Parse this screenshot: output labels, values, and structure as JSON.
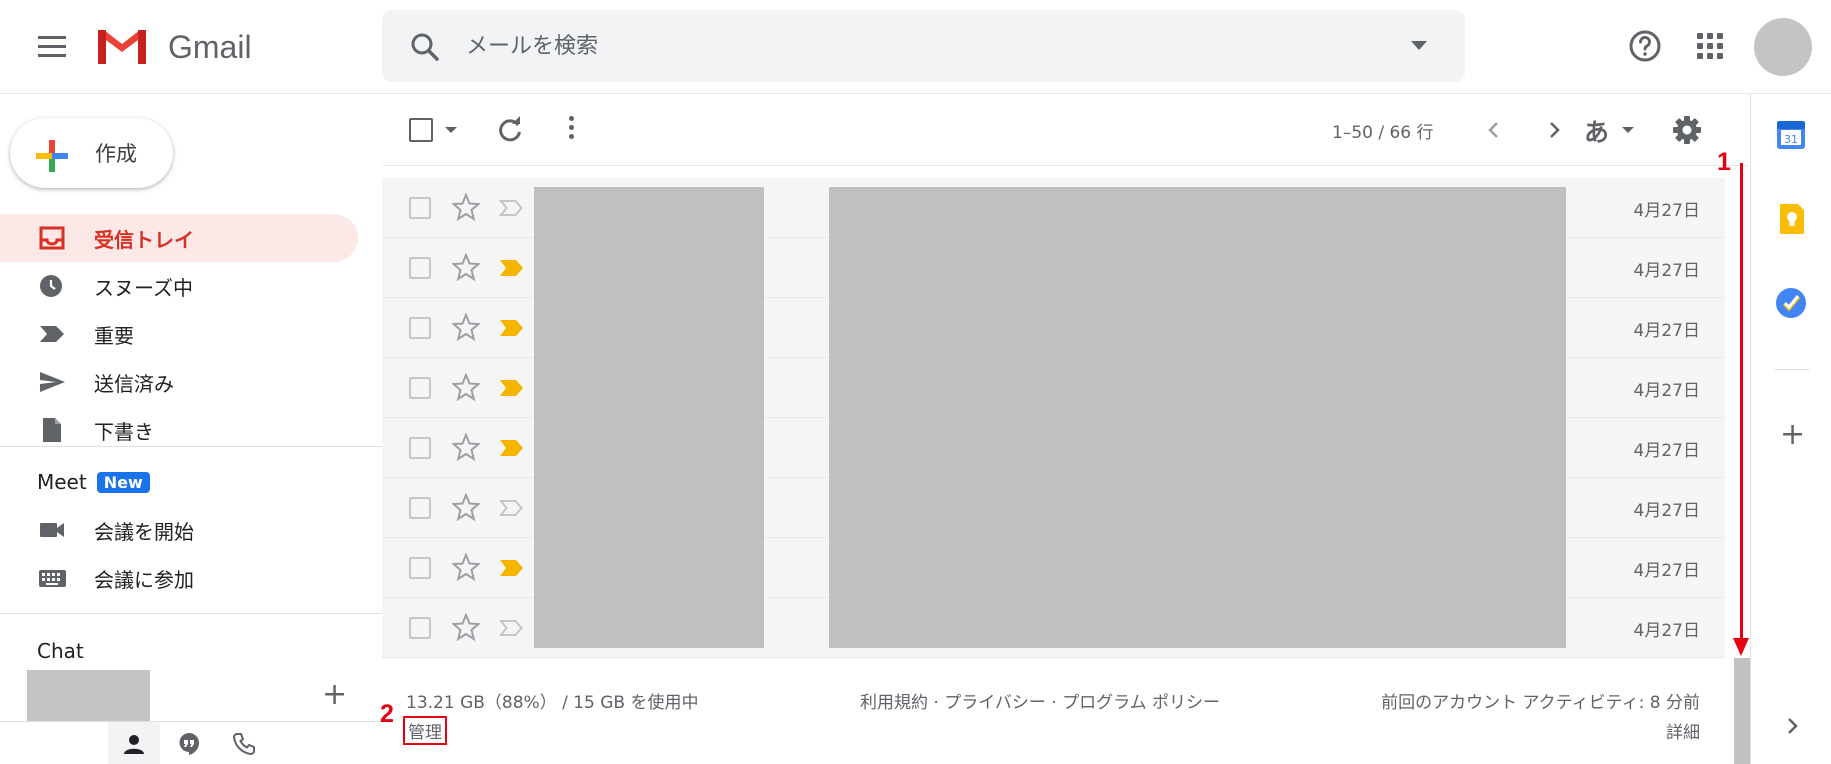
{
  "app": {
    "name": "Gmail"
  },
  "search": {
    "placeholder": "メールを検索"
  },
  "compose": {
    "label": "作成"
  },
  "nav": [
    {
      "label": "受信トレイ",
      "icon": "inbox-icon",
      "active": true
    },
    {
      "label": "スヌーズ中",
      "icon": "clock-icon",
      "active": false
    },
    {
      "label": "重要",
      "icon": "important-icon",
      "active": false
    },
    {
      "label": "送信済み",
      "icon": "send-icon",
      "active": false
    },
    {
      "label": "下書き",
      "icon": "draft-icon",
      "active": false
    }
  ],
  "meet": {
    "title": "Meet",
    "badge": "New",
    "items": [
      {
        "label": "会議を開始",
        "icon": "video-icon"
      },
      {
        "label": "会議に参加",
        "icon": "keyboard-icon"
      }
    ]
  },
  "chat": {
    "title": "Chat"
  },
  "toolbar": {
    "range": "1–50 / 66 行",
    "ime": "あ"
  },
  "emails": [
    {
      "date": "4月27日",
      "important": false
    },
    {
      "date": "4月27日",
      "important": true
    },
    {
      "date": "4月27日",
      "important": true
    },
    {
      "date": "4月27日",
      "important": true
    },
    {
      "date": "4月27日",
      "important": true
    },
    {
      "date": "4月27日",
      "important": false
    },
    {
      "date": "4月27日",
      "important": true
    },
    {
      "date": "4月27日",
      "important": false
    }
  ],
  "footer": {
    "storage": "13.21 GB（88%） / 15 GB を使用中",
    "manage": "管理",
    "terms": "利用規約 · プライバシー · プログラム ポリシー",
    "activity": "前回のアカウント アクティビティ: 8 分前",
    "details": "詳細"
  },
  "annotations": {
    "step1": "1",
    "step2": "2"
  },
  "colors": {
    "accent_red": "#d93025",
    "annotation_red": "#e60012",
    "important_yellow": "#f4b400",
    "new_badge_blue": "#1a73e8"
  }
}
